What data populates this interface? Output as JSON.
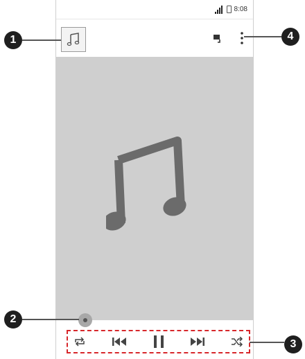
{
  "status_bar": {
    "time": "8:08",
    "signal": "signal-bars-icon",
    "battery": "battery-icon"
  },
  "app_bar": {
    "album_art_icon": "music-note-icon",
    "queue_icon": "playlist-icon",
    "menu_icon": "overflow-menu-icon"
  },
  "now_playing": {
    "cover_icon": "music-note-icon"
  },
  "playback_controls": [
    "repeat-icon",
    "previous-icon",
    "pause-icon",
    "next-icon",
    "shuffle-icon"
  ],
  "callouts": [
    "1",
    "2",
    "3",
    "4"
  ],
  "colors": {
    "cover_bg": "#cfcfcf",
    "note": "#6b6b6b",
    "highlight_border": "#d7262a",
    "callout_bg": "#1f1f1f"
  }
}
